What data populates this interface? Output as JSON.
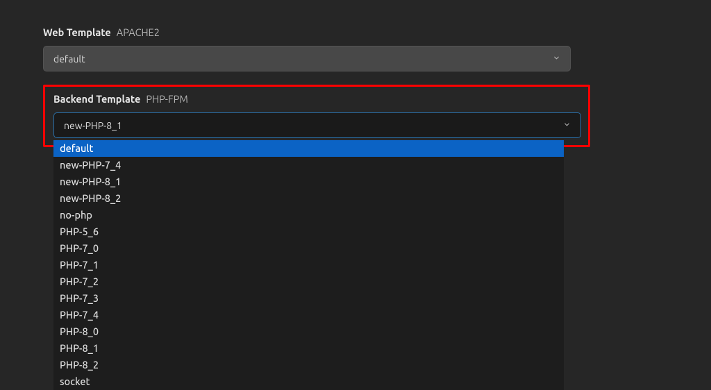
{
  "web_template": {
    "label_main": "Web Template",
    "label_sub": "APACHE2",
    "selected": "default"
  },
  "backend_template": {
    "label_main": "Backend Template",
    "label_sub": "PHP-FPM",
    "selected": "new-PHP-8_1",
    "options": [
      "default",
      "new-PHP-7_4",
      "new-PHP-8_1",
      "new-PHP-8_2",
      "no-php",
      "PHP-5_6",
      "PHP-7_0",
      "PHP-7_1",
      "PHP-7_2",
      "PHP-7_3",
      "PHP-7_4",
      "PHP-8_0",
      "PHP-8_1",
      "PHP-8_2",
      "socket"
    ],
    "highlighted_option_index": 0
  }
}
